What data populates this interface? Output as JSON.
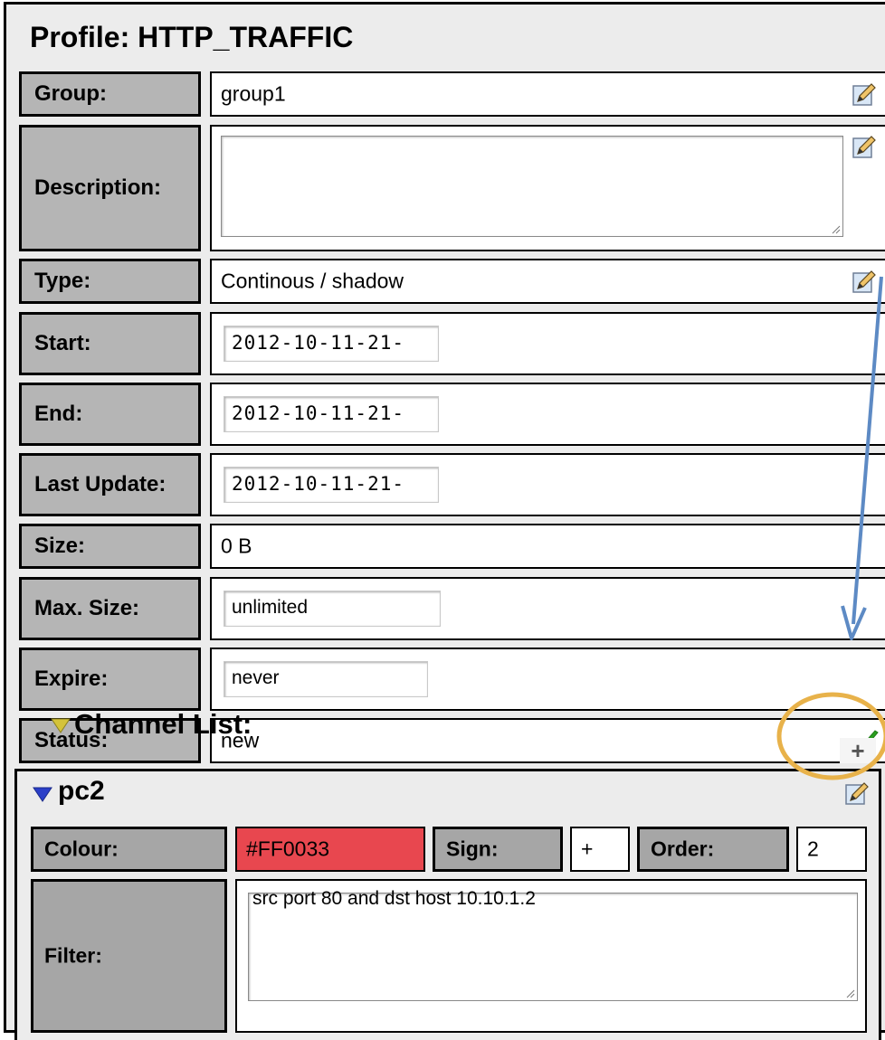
{
  "profile": {
    "title": "Profile: HTTP_TRAFFIC"
  },
  "fields": {
    "group": {
      "label": "Group:",
      "value": "group1"
    },
    "description": {
      "label": "Description:",
      "value": ""
    },
    "type": {
      "label": "Type:",
      "value": "Continous / shadow"
    },
    "start": {
      "label": "Start:",
      "value": "2012-10-11-21-"
    },
    "end": {
      "label": "End:",
      "value": "2012-10-11-21-"
    },
    "last_update": {
      "label": "Last Update:",
      "value": "2012-10-11-21-"
    },
    "size": {
      "label": "Size:",
      "value": "0 B"
    },
    "max_size": {
      "label": "Max. Size:",
      "value": "unlimited"
    },
    "expire": {
      "label": "Expire:",
      "value": "never"
    },
    "status": {
      "label": "Status:",
      "value": "new"
    }
  },
  "channel_list": {
    "title": "Channel List:",
    "add_label": "+"
  },
  "channel": {
    "name": "pc2",
    "colour_label": "Colour:",
    "colour_value": "#FF0033",
    "sign_label": "Sign:",
    "sign_value": "+",
    "order_label": "Order:",
    "order_value": "2",
    "filter_label": "Filter:",
    "filter_value": "src port 80 and dst host 10.10.1.2"
  },
  "icons": {
    "edit": "edit-pencil-icon",
    "status": "checkmark-icon",
    "collapse": "triangle-down-icon"
  },
  "colors": {
    "label_bg": "#b5b5b5",
    "channel_colour": "#e8474f",
    "check": "#2aa01f",
    "annotation_circle": "#e8b24a",
    "annotation_arrow": "#5d8ac4"
  }
}
